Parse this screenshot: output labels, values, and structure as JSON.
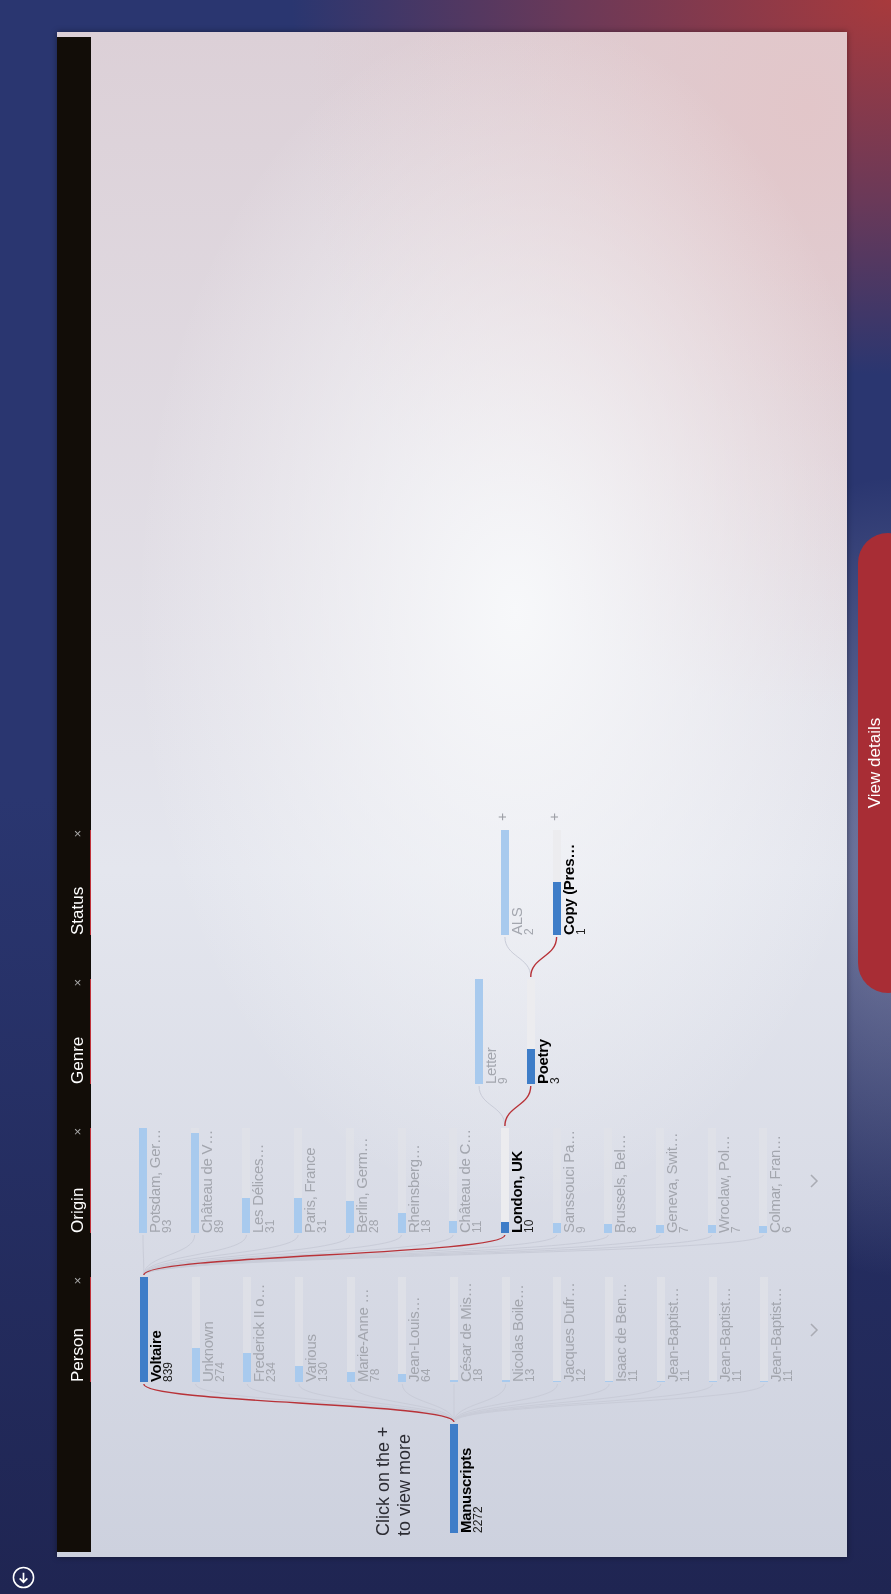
{
  "tabs": [
    {
      "label": "Person",
      "close": "×"
    },
    {
      "label": "Origin",
      "close": "×"
    },
    {
      "label": "Genre",
      "close": "×"
    },
    {
      "label": "Status",
      "close": "×"
    }
  ],
  "hint": [
    "Click on the +",
    "to view more"
  ],
  "root": {
    "label": "Manuscripts",
    "value": "2272",
    "level": 1,
    "selected": true
  },
  "levels": [
    {
      "more": true,
      "nodes": [
        {
          "label": "Voltaire",
          "value": "839",
          "level": 1,
          "selected": true
        },
        {
          "label": "Unknown",
          "value": "274",
          "level": 0.327,
          "selected": false
        },
        {
          "label": "Frederick II o…",
          "value": "234",
          "level": 0.279,
          "selected": false
        },
        {
          "label": "Various",
          "value": "130",
          "level": 0.155,
          "selected": false
        },
        {
          "label": "Marie-Anne …",
          "value": "78",
          "level": 0.093,
          "selected": false
        },
        {
          "label": "Jean-Louis…",
          "value": "64",
          "level": 0.076,
          "selected": false
        },
        {
          "label": "César de Mis…",
          "value": "18",
          "level": 0.021,
          "selected": false
        },
        {
          "label": "Nicolas Boile…",
          "value": "13",
          "level": 0.015,
          "selected": false
        },
        {
          "label": "Jacques Dufr…",
          "value": "12",
          "level": 0.014,
          "selected": false
        },
        {
          "label": "Isaac de Ben…",
          "value": "11",
          "level": 0.013,
          "selected": false
        },
        {
          "label": "Jean-Baptist…",
          "value": "11",
          "level": 0.013,
          "selected": false
        },
        {
          "label": "Jean-Baptist…",
          "value": "11",
          "level": 0.013,
          "selected": false
        },
        {
          "label": "Jean-Baptist…",
          "value": "11",
          "level": 0.013,
          "selected": false
        }
      ]
    },
    {
      "more": true,
      "nodes": [
        {
          "label": "Potsdam, Ger…",
          "value": "93",
          "level": 1,
          "selected": false
        },
        {
          "label": "Château de V…",
          "value": "89",
          "level": 0.957,
          "selected": false
        },
        {
          "label": "Les Délices…",
          "value": "31",
          "level": 0.333,
          "selected": false
        },
        {
          "label": "Paris, France",
          "value": "31",
          "level": 0.333,
          "selected": false
        },
        {
          "label": "Berlin, Germ…",
          "value": "28",
          "level": 0.301,
          "selected": false
        },
        {
          "label": "Rheinsberg…",
          "value": "18",
          "level": 0.194,
          "selected": false
        },
        {
          "label": "Château de C…",
          "value": "11",
          "level": 0.118,
          "selected": false
        },
        {
          "label": "London, UK",
          "value": "10",
          "level": 0.108,
          "selected": true
        },
        {
          "label": "Sanssouci Pa…",
          "value": "9",
          "level": 0.097,
          "selected": false
        },
        {
          "label": "Brussels, Bel…",
          "value": "8",
          "level": 0.086,
          "selected": false
        },
        {
          "label": "Geneva, Swit…",
          "value": "7",
          "level": 0.075,
          "selected": false
        },
        {
          "label": "Wroclaw, Pol…",
          "value": "7",
          "level": 0.075,
          "selected": false
        },
        {
          "label": "Colmar, Fran…",
          "value": "6",
          "level": 0.065,
          "selected": false
        }
      ]
    },
    {
      "nodes": [
        {
          "label": "Letter",
          "value": "9",
          "level": 1,
          "selected": false
        },
        {
          "label": "Poetry",
          "value": "3",
          "level": 0.333,
          "selected": true
        }
      ]
    },
    {
      "nodes": [
        {
          "label": "ALS",
          "value": "2",
          "level": 1,
          "selected": false,
          "expand": "+"
        },
        {
          "label": "Copy (Pres…",
          "value": "1",
          "level": 0.5,
          "selected": true,
          "expand": "+"
        }
      ]
    }
  ],
  "button": "View details"
}
